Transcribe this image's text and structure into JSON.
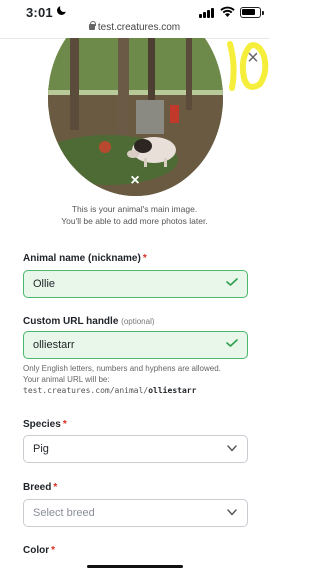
{
  "status": {
    "time": "3:01"
  },
  "url_bar": {
    "domain": "test.creatures.com"
  },
  "photo": {
    "remove_icon": "×",
    "close_icon": "×"
  },
  "caption": {
    "line1": "This is your animal's main image.",
    "line2": "You'll be able to add more photos later."
  },
  "animal_name": {
    "label": "Animal name (nickname)",
    "required_mark": "*",
    "value": "Ollie"
  },
  "url_handle": {
    "label": "Custom URL handle",
    "optional": "(optional)",
    "value": "olliestarr",
    "help_line1": "Only English letters, numbers and hyphens are allowed.",
    "help_line2": "Your animal URL will be:",
    "url_prefix": "test.creatures.com/animal/",
    "url_handle": "olliestarr"
  },
  "species": {
    "label": "Species",
    "required_mark": "*",
    "value": "Pig"
  },
  "breed": {
    "label": "Breed",
    "required_mark": "*",
    "placeholder": "Select breed"
  },
  "color": {
    "label": "Color",
    "required_mark": "*"
  },
  "colors": {
    "valid_bg": "#e8f7ea",
    "valid_border": "#49b86a",
    "required": "#d92d20"
  }
}
